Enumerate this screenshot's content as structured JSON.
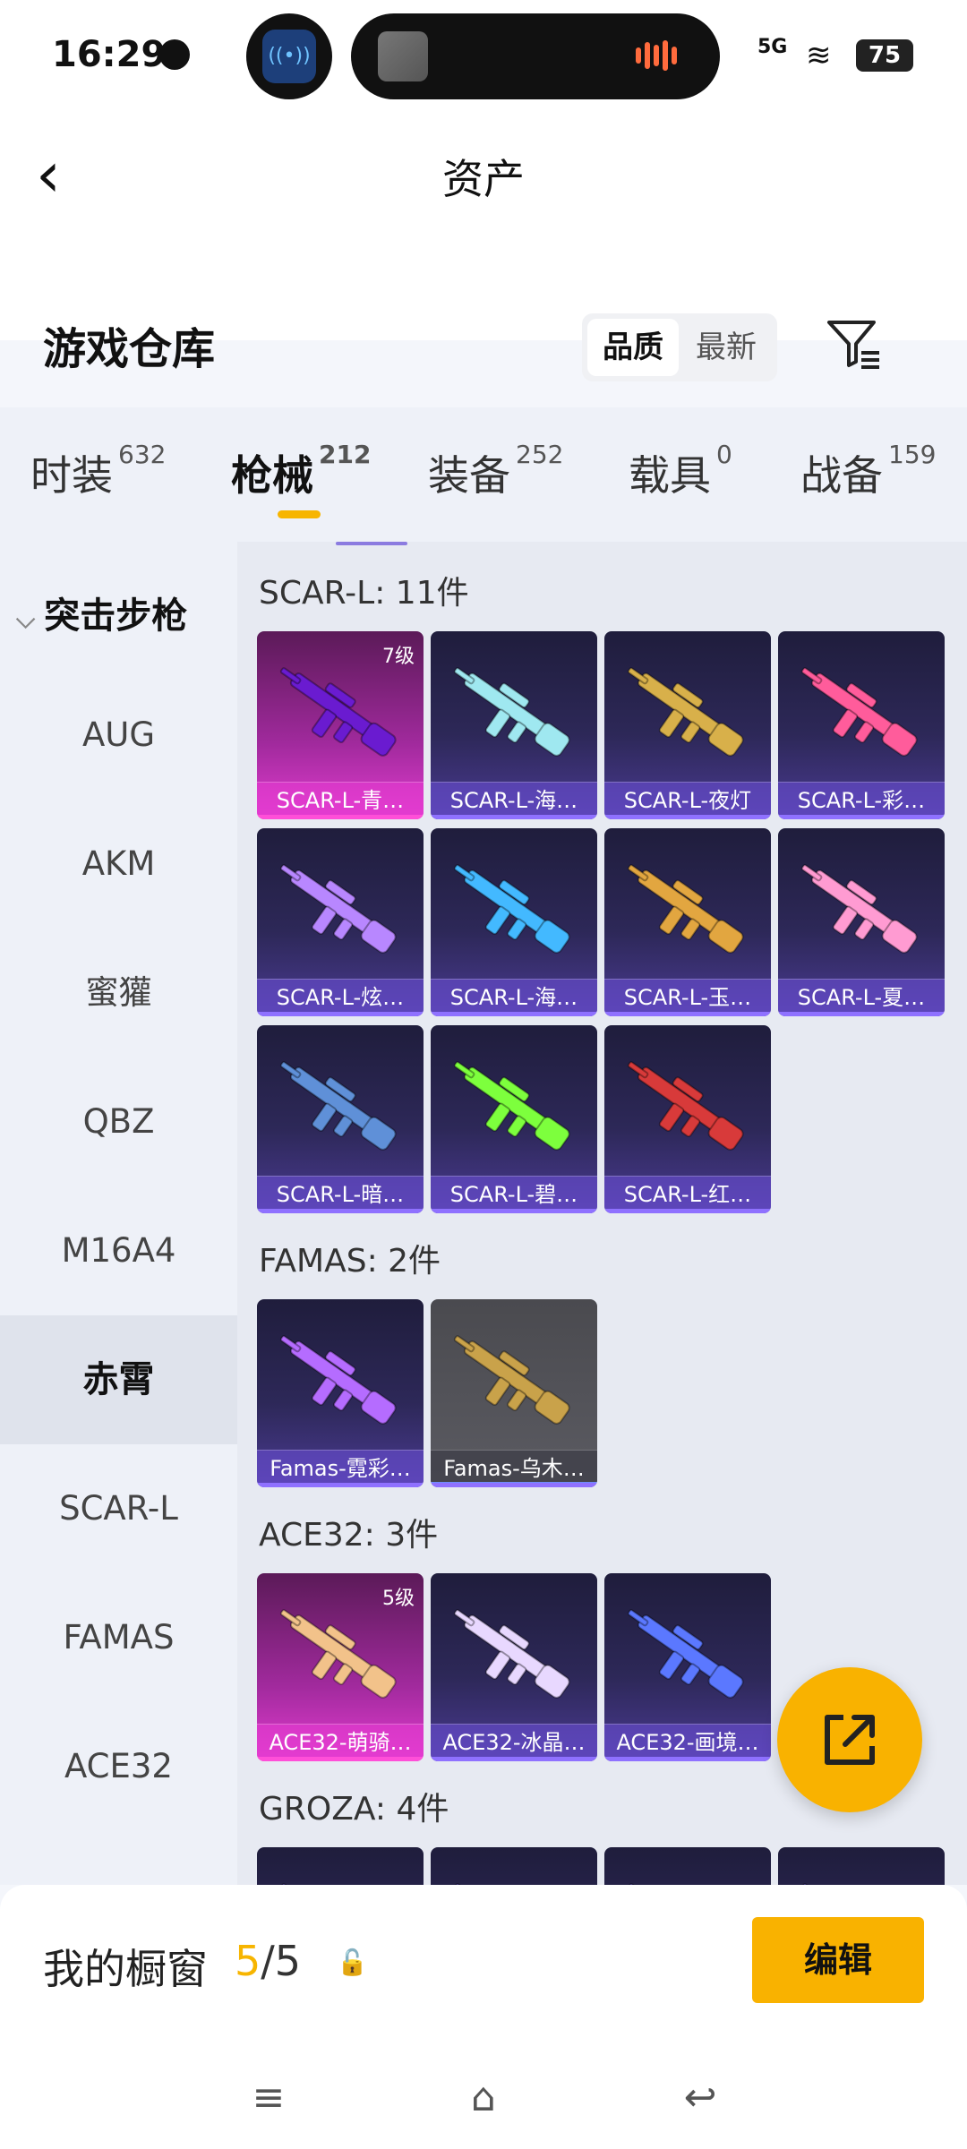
{
  "status": {
    "time": "16:29",
    "network": "5G",
    "battery": "75"
  },
  "header": {
    "title": "资产",
    "subtitle": "游戏仓库",
    "sort_options": [
      "品质",
      "最新"
    ]
  },
  "tabs": [
    {
      "label": "时装",
      "count": "632"
    },
    {
      "label": "枪械",
      "count": "212"
    },
    {
      "label": "装备",
      "count": "252"
    },
    {
      "label": "载具",
      "count": "0"
    },
    {
      "label": "战备",
      "count": "159"
    }
  ],
  "sidebar": {
    "group": "突击步枪",
    "items": [
      "AUG",
      "AKM",
      "蜜獾",
      "QBZ",
      "M16A4",
      "赤霄",
      "SCAR-L",
      "FAMAS",
      "ACE32"
    ]
  },
  "sections": [
    {
      "title": "SCAR-L: 11件",
      "items": [
        {
          "name": "SCAR-L-青…",
          "level": "7级",
          "rarity": "legendary",
          "color": "#6a1bd0"
        },
        {
          "name": "SCAR-L-海…",
          "rarity": "epic",
          "color": "#9fe8f0"
        },
        {
          "name": "SCAR-L-夜灯",
          "rarity": "epic",
          "color": "#d8b04a"
        },
        {
          "name": "SCAR-L-彩…",
          "rarity": "epic",
          "color": "#ff5c9b"
        },
        {
          "name": "SCAR-L-炫…",
          "rarity": "epic",
          "color": "#b887ff"
        },
        {
          "name": "SCAR-L-海…",
          "rarity": "epic",
          "color": "#43b9ff"
        },
        {
          "name": "SCAR-L-玉…",
          "rarity": "epic",
          "color": "#e2a640"
        },
        {
          "name": "SCAR-L-夏…",
          "rarity": "epic",
          "color": "#ff9bd2"
        },
        {
          "name": "SCAR-L-暗…",
          "rarity": "epic",
          "color": "#5f90d8"
        },
        {
          "name": "SCAR-L-碧…",
          "rarity": "epic",
          "color": "#7dff3d"
        },
        {
          "name": "SCAR-L-红…",
          "rarity": "epic",
          "color": "#d83a3a"
        }
      ]
    },
    {
      "title": "FAMAS: 2件",
      "items": [
        {
          "name": "Famas-霓彩…",
          "rarity": "epic",
          "color": "#b56cff"
        },
        {
          "name": "Famas-乌木…",
          "rarity": "rare",
          "color": "#c9a24a"
        }
      ]
    },
    {
      "title": "ACE32: 3件",
      "items": [
        {
          "name": "ACE32-萌骑…",
          "level": "5级",
          "rarity": "legendary",
          "color": "#f2c28a"
        },
        {
          "name": "ACE32-冰晶…",
          "rarity": "epic",
          "color": "#e8d8ff"
        },
        {
          "name": "ACE32-画境…",
          "rarity": "epic",
          "color": "#5b78ff"
        }
      ]
    },
    {
      "title": "GROZA: 4件",
      "items": []
    }
  ],
  "showcase": {
    "title": "我的橱窗",
    "current": "5",
    "total": "/5",
    "edit_label": "编辑"
  },
  "colors": {
    "accent": "#f9b200",
    "legendary": "#e23ccf",
    "epic": "#8f71ff"
  }
}
